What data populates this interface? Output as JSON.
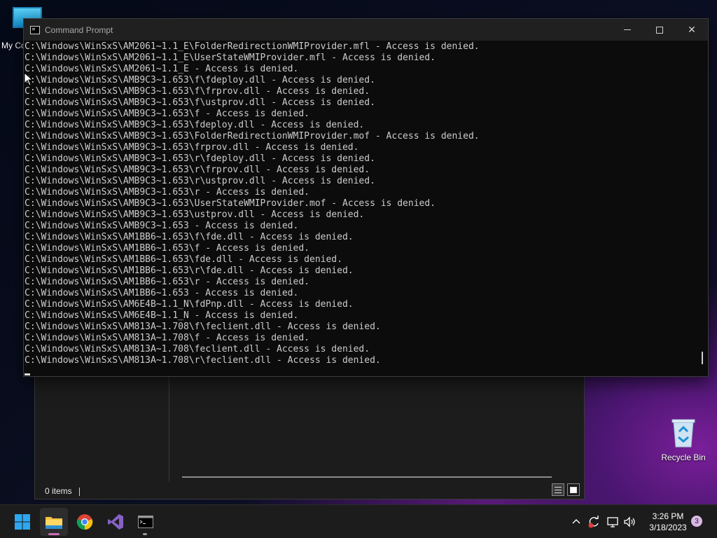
{
  "desktop": {
    "icons": [
      {
        "label": "My Co"
      },
      {
        "label": "Recycle Bin"
      }
    ]
  },
  "explorer": {
    "status_text": "0 items"
  },
  "cmd": {
    "title": "Command Prompt",
    "lines": [
      "C:\\Windows\\WinSxS\\AM2061~1.1_E\\FolderRedirectionWMIProvider.mfl - Access is denied.",
      "C:\\Windows\\WinSxS\\AM2061~1.1_E\\UserStateWMIProvider.mfl - Access is denied.",
      "C:\\Windows\\WinSxS\\AM2061~1.1_E - Access is denied.",
      "C:\\Windows\\WinSxS\\AMB9C3~1.653\\f\\fdeploy.dll - Access is denied.",
      "C:\\Windows\\WinSxS\\AMB9C3~1.653\\f\\frprov.dll - Access is denied.",
      "C:\\Windows\\WinSxS\\AMB9C3~1.653\\f\\ustprov.dll - Access is denied.",
      "C:\\Windows\\WinSxS\\AMB9C3~1.653\\f - Access is denied.",
      "C:\\Windows\\WinSxS\\AMB9C3~1.653\\fdeploy.dll - Access is denied.",
      "C:\\Windows\\WinSxS\\AMB9C3~1.653\\FolderRedirectionWMIProvider.mof - Access is denied.",
      "C:\\Windows\\WinSxS\\AMB9C3~1.653\\frprov.dll - Access is denied.",
      "C:\\Windows\\WinSxS\\AMB9C3~1.653\\r\\fdeploy.dll - Access is denied.",
      "C:\\Windows\\WinSxS\\AMB9C3~1.653\\r\\frprov.dll - Access is denied.",
      "C:\\Windows\\WinSxS\\AMB9C3~1.653\\r\\ustprov.dll - Access is denied.",
      "C:\\Windows\\WinSxS\\AMB9C3~1.653\\r - Access is denied.",
      "C:\\Windows\\WinSxS\\AMB9C3~1.653\\UserStateWMIProvider.mof - Access is denied.",
      "C:\\Windows\\WinSxS\\AMB9C3~1.653\\ustprov.dll - Access is denied.",
      "C:\\Windows\\WinSxS\\AMB9C3~1.653 - Access is denied.",
      "C:\\Windows\\WinSxS\\AM1BB6~1.653\\f\\fde.dll - Access is denied.",
      "C:\\Windows\\WinSxS\\AM1BB6~1.653\\f - Access is denied.",
      "C:\\Windows\\WinSxS\\AM1BB6~1.653\\fde.dll - Access is denied.",
      "C:\\Windows\\WinSxS\\AM1BB6~1.653\\r\\fde.dll - Access is denied.",
      "C:\\Windows\\WinSxS\\AM1BB6~1.653\\r - Access is denied.",
      "C:\\Windows\\WinSxS\\AM1BB6~1.653 - Access is denied.",
      "C:\\Windows\\WinSxS\\AM6E4B~1.1_N\\fdPnp.dll - Access is denied.",
      "C:\\Windows\\WinSxS\\AM6E4B~1.1_N - Access is denied.",
      "C:\\Windows\\WinSxS\\AM813A~1.708\\f\\feclient.dll - Access is denied.",
      "C:\\Windows\\WinSxS\\AM813A~1.708\\f - Access is denied.",
      "C:\\Windows\\WinSxS\\AM813A~1.708\\feclient.dll - Access is denied.",
      "C:\\Windows\\WinSxS\\AM813A~1.708\\r\\feclient.dll - Access is denied."
    ]
  },
  "taskbar": {
    "apps": [
      {
        "icon": "windows-start-icon"
      },
      {
        "icon": "file-explorer-icon"
      },
      {
        "icon": "chrome-icon"
      },
      {
        "icon": "visual-studio-icon"
      },
      {
        "icon": "terminal-icon"
      }
    ],
    "clock": {
      "time": "3:26 PM",
      "date": "3/18/2023"
    },
    "notification_count": "3"
  },
  "colors": {
    "console_bg": "#0c0c0c",
    "console_text": "#cccccc",
    "taskbar_bg": "#1c1c1c",
    "accent_underline": "#c86fb8"
  }
}
